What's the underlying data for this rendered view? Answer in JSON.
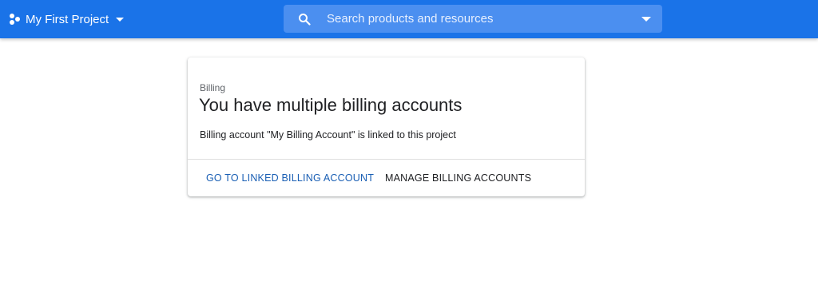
{
  "header": {
    "project_name": "My First Project",
    "search_placeholder": "Search products and resources"
  },
  "billing_card": {
    "section_label": "Billing",
    "title": "You have multiple billing accounts",
    "body": "Billing account \"My Billing Account\" is linked to this project",
    "actions": {
      "primary_label": "GO TO LINKED BILLING ACCOUNT",
      "secondary_label": "MANAGE BILLING ACCOUNTS"
    }
  },
  "colors": {
    "header_bg": "#1a73e8",
    "search_bg": "#4b8ff0",
    "link_blue": "#1a5fb4",
    "text_primary": "#202124",
    "text_secondary": "#5f6368"
  },
  "icons": {
    "project": "project-hexagon-icon",
    "project_caret": "caret-down-icon",
    "search": "search-icon",
    "search_expand": "caret-down-icon"
  }
}
